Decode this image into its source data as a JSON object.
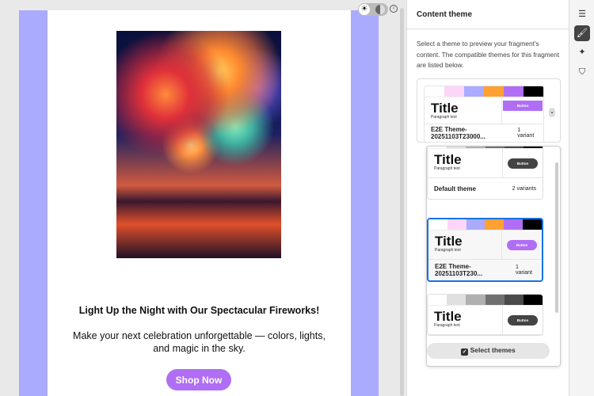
{
  "email": {
    "headline": "Light Up the Night with Our Spectacular Fireworks!",
    "paragraph": "Make your next celebration unforgettable — colors, lights, and magic in the sky.",
    "cta": "Shop Now",
    "hero_alt": "fireworks over water"
  },
  "panel": {
    "title": "Content theme",
    "description": "Select a theme to preview your fragment's content. The compatible themes for this fragment are listed below.",
    "selected": {
      "name": "E2E Theme-20251103T23000...",
      "variants": "1 variant",
      "title": "Title",
      "paragraph": "Paragraph text",
      "button": "Button",
      "swatches": [
        "#ffffff",
        "#fbd6f8",
        "#aaaaff",
        "#ffa033",
        "#b06ef5",
        "#000000"
      ],
      "button_color": "#b06ef5"
    },
    "options": [
      {
        "name": "Default theme",
        "variants": "2 variants",
        "title": "Title",
        "paragraph": "Paragraph text",
        "button": "Button",
        "swatches": [
          "#ffffff",
          "#e0e0e0",
          "#b0b0b0",
          "#707070",
          "#4a4a4a",
          "#000000"
        ],
        "button_color": "#444444"
      },
      {
        "name": "E2E Theme-20251103T230...",
        "variants": "1 variant",
        "title": "Title",
        "paragraph": "Paragraph text",
        "button": "Button",
        "swatches": [
          "#ffffff",
          "#fbd6f8",
          "#aaaaff",
          "#ffa033",
          "#b06ef5",
          "#000000"
        ],
        "button_color": "#b06ef5"
      },
      {
        "name": "",
        "variants": "",
        "title": "Title",
        "paragraph": "Paragraph text",
        "button": "Button",
        "swatches": [
          "#ffffff",
          "#e0e0e0",
          "#b0b0b0",
          "#707070",
          "#4a4a4a",
          "#000000"
        ],
        "button_color": "#444444"
      }
    ],
    "select_themes": "Select themes"
  },
  "accent": "#1473e6"
}
